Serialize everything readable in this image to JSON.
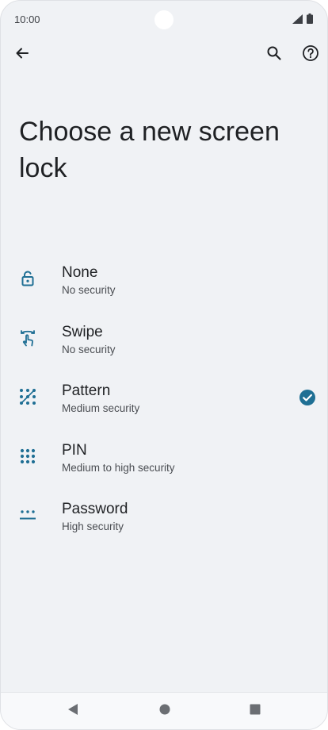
{
  "status_bar": {
    "time": "10:00",
    "icons": [
      "signal-icon",
      "battery-icon"
    ]
  },
  "app_bar": {
    "icons": [
      "back-arrow-icon",
      "search-icon",
      "help-icon"
    ]
  },
  "page": {
    "title": "Choose a new screen lock"
  },
  "lock_options": [
    {
      "icon": "padlock-open-icon",
      "label": "None",
      "sublabel": "No security",
      "selected": false
    },
    {
      "icon": "swipe-icon",
      "label": "Swipe",
      "sublabel": "No security",
      "selected": false
    },
    {
      "icon": "pattern-icon",
      "label": "Pattern",
      "sublabel": "Medium security",
      "selected": true
    },
    {
      "icon": "pin-keypad-icon",
      "label": "PIN",
      "sublabel": "Medium to high security",
      "selected": false
    },
    {
      "icon": "password-icon",
      "label": "Password",
      "sublabel": "High security",
      "selected": false
    }
  ],
  "nav_bar": {
    "icons": [
      "nav-back-icon",
      "nav-home-icon",
      "nav-recents-icon"
    ]
  },
  "colors": {
    "background": "#f0f2f5",
    "accent": "#1f6f94",
    "text_primary": "#1f2124",
    "text_secondary": "#4a4d52"
  }
}
